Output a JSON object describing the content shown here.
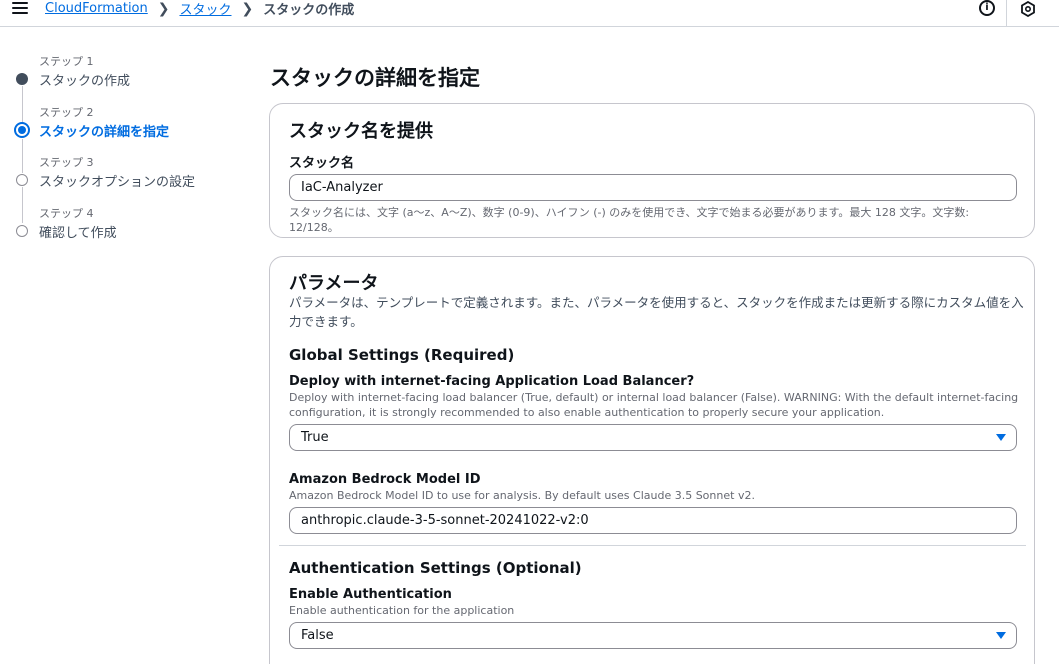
{
  "breadcrumb": {
    "items": [
      "CloudFormation",
      "スタック"
    ],
    "current": "スタックの作成"
  },
  "steps": [
    {
      "num": "ステップ 1",
      "label": "スタックの作成",
      "state": "done"
    },
    {
      "num": "ステップ 2",
      "label": "スタックの詳細を指定",
      "state": "current"
    },
    {
      "num": "ステップ 3",
      "label": "スタックオプションの設定",
      "state": "todo"
    },
    {
      "num": "ステップ 4",
      "label": "確認して作成",
      "state": "todo"
    }
  ],
  "page_title": "スタックの詳細を指定",
  "stack_name_card": {
    "title": "スタック名を提供",
    "label": "スタック名",
    "value": "IaC-Analyzer",
    "hint": "スタック名には、文字 (a〜z、A〜Z)、数字 (0-9)、ハイフン (-) のみを使用でき、文字で始まる必要があります。最大 128 文字。文字数:　12/128。"
  },
  "params_card": {
    "title": "パラメータ",
    "description": "パラメータは、テンプレートで定義されます。また、パラメータを使用すると、スタックを作成または更新する際にカスタム値を入力できます。",
    "global_section": "Global Settings (Required)",
    "alb_label": "Deploy with internet-facing Application Load Balancer?",
    "alb_desc": "Deploy with internet-facing load balancer (True, default) or internal load balancer (False). WARNING: With the default internet-facing configuration, it is strongly recommended to also enable authentication to properly secure your application.",
    "alb_value": "True",
    "model_label": "Amazon Bedrock Model ID",
    "model_desc": "Amazon Bedrock Model ID to use for analysis. By default uses Claude 3.5 Sonnet v2.",
    "model_value": "anthropic.claude-3-5-sonnet-20241022-v2:0",
    "auth_section": "Authentication Settings (Optional)",
    "auth_label": "Enable Authentication",
    "auth_desc": "Enable authentication for the application",
    "auth_value": "False"
  },
  "icons": {
    "menu": "hamburger-menu-icon",
    "info": "info-circle-icon",
    "cloudshell": "cloudshell-icon"
  },
  "colors": {
    "link": "#006ce0",
    "text": "#0f141a",
    "muted": "#656871",
    "border": "#c6c6cd"
  }
}
